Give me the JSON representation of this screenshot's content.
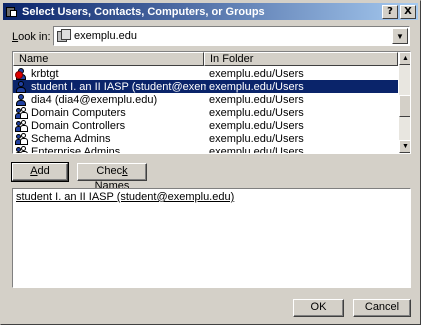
{
  "window": {
    "title": "Select Users, Contacts, Computers, or Groups",
    "help_button": "?",
    "close_button": "X"
  },
  "lookin": {
    "label_prefix": "",
    "label_underlined": "L",
    "label_suffix": "ook in:",
    "value": "exemplu.edu"
  },
  "list": {
    "columns": [
      "Name",
      "In Folder"
    ],
    "rows": [
      {
        "name": "krbtgt",
        "folder": "exemplu.edu/Users",
        "icon": "disabled-user-icon",
        "selected": false
      },
      {
        "name": "student I. an II IASP (student@exemplu.edu)",
        "folder": "exemplu.edu/Users",
        "icon": "user-icon",
        "selected": true
      },
      {
        "name": "dia4 (dia4@exemplu.edu)",
        "folder": "exemplu.edu/Users",
        "icon": "user-icon",
        "selected": false
      },
      {
        "name": "Domain Computers",
        "folder": "exemplu.edu/Users",
        "icon": "group-icon",
        "selected": false
      },
      {
        "name": "Domain Controllers",
        "folder": "exemplu.edu/Users",
        "icon": "group-icon",
        "selected": false
      },
      {
        "name": "Schema Admins",
        "folder": "exemplu.edu/Users",
        "icon": "group-icon",
        "selected": false
      },
      {
        "name": "Enterprise Admins",
        "folder": "exemplu.edu/Users",
        "icon": "group-icon",
        "selected": false
      }
    ]
  },
  "buttons": {
    "add_u": "A",
    "add_rest": "dd",
    "check_pre": "Chec",
    "check_u": "k",
    "check_rest": " Names",
    "ok": "OK",
    "cancel": "Cancel"
  },
  "selected_text": "student I. an II IASP (student@exemplu.edu)",
  "colors": {
    "selection": "#0a246a",
    "face": "#d4d0c8"
  }
}
